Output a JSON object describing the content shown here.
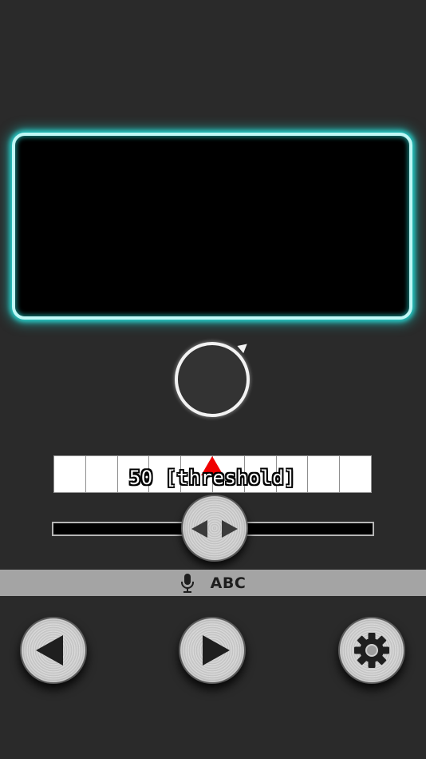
{
  "threshold": {
    "value": 50,
    "label": "50 [threshold]",
    "scale_divisions": 10
  },
  "slider": {
    "position_fraction": 0.5
  },
  "voice_input": {
    "icon": "microphone-icon",
    "label": "ABC"
  },
  "controls": {
    "prev_icon": "chevron-left-icon",
    "play_icon": "play-icon",
    "settings_icon": "gear-icon"
  },
  "colors": {
    "background": "#2a2a2a",
    "display_glow": "#27c9c5",
    "display_border": "#bff8f6",
    "threshold_marker": "#f00000",
    "voice_bar": "#a4a4a4"
  }
}
